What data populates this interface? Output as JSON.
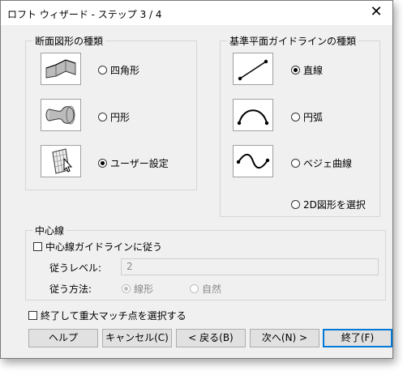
{
  "window": {
    "title": "ロフト ウィザード - ステップ 3 / 4",
    "close_glyph": "✕"
  },
  "profile": {
    "title": "断面図形の種類",
    "options": [
      {
        "label": "四角形",
        "selected": false
      },
      {
        "label": "円形",
        "selected": false
      },
      {
        "label": "ユーザー設定",
        "selected": true
      }
    ]
  },
  "guide": {
    "title": "基準平面ガイドラインの種類",
    "options": [
      {
        "label": "直線",
        "selected": true
      },
      {
        "label": "円弧",
        "selected": false
      },
      {
        "label": "ベジェ曲線",
        "selected": false
      },
      {
        "label": "2D図形を選択",
        "selected": false
      }
    ]
  },
  "centerline": {
    "title": "中心線",
    "follow_label": "中心線ガイドラインに従う",
    "level_label": "従うレベル:",
    "level_value": "2",
    "method_label": "従う方法:",
    "method_options": [
      {
        "label": "線形",
        "selected": true
      },
      {
        "label": "自然",
        "selected": false
      }
    ]
  },
  "finish_check_label": "終了して重大マッチ点を選択する",
  "buttons": {
    "help": "ヘルプ",
    "cancel": "キャンセル(C)",
    "back": "< 戻る(B)",
    "next": "次へ(N) >",
    "finish": "終了(F)"
  }
}
